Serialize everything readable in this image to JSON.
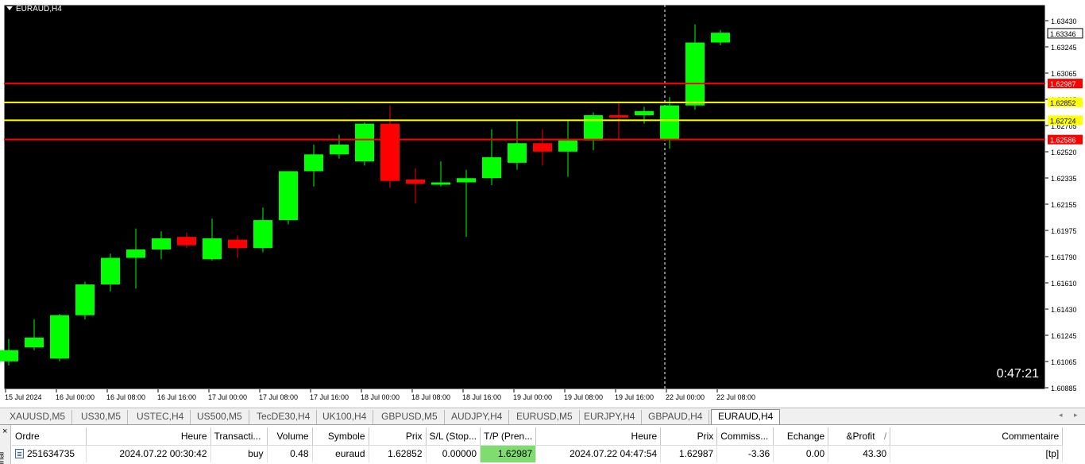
{
  "chart": {
    "title": "EURAUD,H4",
    "timer": "0:47:21",
    "colors": {
      "background": "#000000",
      "bull": "#00ff00",
      "bear": "#ff0000",
      "axis_text": "#000000",
      "grid_frame": "#ffffff"
    },
    "price_ticks": [
      "1.63430",
      "1.63245",
      "1.63065",
      "1.62885",
      "1.62705",
      "1.62520",
      "1.62335",
      "1.62155",
      "1.61975",
      "1.61790",
      "1.61610",
      "1.61430",
      "1.61245",
      "1.61065",
      "1.60885"
    ],
    "time_labels": [
      "15 Jul 2024",
      "16 Jul 00:00",
      "16 Jul 08:00",
      "16 Jul 16:00",
      "17 Jul 00:00",
      "17 Jul 08:00",
      "17 Jul 16:00",
      "18 Jul 00:00",
      "18 Jul 08:00",
      "18 Jul 16:00",
      "19 Jul 00:00",
      "19 Jul 08:00",
      "19 Jul 16:00",
      "22 Jul 00:00",
      "22 Jul 08:00"
    ],
    "price_lines": [
      {
        "label": "1.62987",
        "price": 1.62987,
        "color": "#ff0000",
        "label_bg": "#ff0000",
        "label_fg": "#ffffff"
      },
      {
        "label": "1.62852",
        "price": 1.62852,
        "color": "#ffff00",
        "label_bg": "#ffff00",
        "label_fg": "#000000"
      },
      {
        "label": "1.62724",
        "price": 1.62724,
        "color": "#ffff00",
        "label_bg": "#ffff00",
        "label_fg": "#000000"
      },
      {
        "label": "1.62586",
        "price": 1.62586,
        "color": "#ff0000",
        "label_bg": "#ff0000",
        "label_fg": "#ffffff"
      }
    ],
    "current_price": {
      "label": "1.63346",
      "price": 1.63346
    }
  },
  "chart_data": {
    "type": "candlestick",
    "title": "EURAUD,H4",
    "ylim": [
      1.608,
      1.6355
    ],
    "candles": [
      {
        "o": 1.61,
        "h": 1.6116,
        "l": 1.6097,
        "c": 1.6108
      },
      {
        "o": 1.611,
        "h": 1.613,
        "l": 1.6108,
        "c": 1.6117
      },
      {
        "o": 1.6102,
        "h": 1.6134,
        "l": 1.61,
        "c": 1.6133
      },
      {
        "o": 1.6133,
        "h": 1.6157,
        "l": 1.613,
        "c": 1.6155
      },
      {
        "o": 1.6155,
        "h": 1.6177,
        "l": 1.615,
        "c": 1.6174
      },
      {
        "o": 1.6174,
        "h": 1.6195,
        "l": 1.6152,
        "c": 1.618
      },
      {
        "o": 1.618,
        "h": 1.6193,
        "l": 1.6173,
        "c": 1.6188
      },
      {
        "o": 1.6189,
        "h": 1.6192,
        "l": 1.6181,
        "c": 1.6183
      },
      {
        "o": 1.6173,
        "h": 1.6202,
        "l": 1.6172,
        "c": 1.6188
      },
      {
        "o": 1.6187,
        "h": 1.619,
        "l": 1.6174,
        "c": 1.6181
      },
      {
        "o": 1.6181,
        "h": 1.621,
        "l": 1.6178,
        "c": 1.6201
      },
      {
        "o": 1.6201,
        "h": 1.6236,
        "l": 1.6198,
        "c": 1.6236
      },
      {
        "o": 1.6236,
        "h": 1.6255,
        "l": 1.6225,
        "c": 1.6248
      },
      {
        "o": 1.6248,
        "h": 1.6262,
        "l": 1.6245,
        "c": 1.6255
      },
      {
        "o": 1.6243,
        "h": 1.6271,
        "l": 1.624,
        "c": 1.627
      },
      {
        "o": 1.627,
        "h": 1.6283,
        "l": 1.6224,
        "c": 1.6229
      },
      {
        "o": 1.623,
        "h": 1.6238,
        "l": 1.6213,
        "c": 1.6227
      },
      {
        "o": 1.6227,
        "h": 1.6243,
        "l": 1.6225,
        "c": 1.6228
      },
      {
        "o": 1.6228,
        "h": 1.6237,
        "l": 1.6189,
        "c": 1.6231
      },
      {
        "o": 1.6231,
        "h": 1.6266,
        "l": 1.6226,
        "c": 1.6246
      },
      {
        "o": 1.6242,
        "h": 1.6273,
        "l": 1.6237,
        "c": 1.6256
      },
      {
        "o": 1.6256,
        "h": 1.6266,
        "l": 1.624,
        "c": 1.625
      },
      {
        "o": 1.625,
        "h": 1.6272,
        "l": 1.6232,
        "c": 1.6258
      },
      {
        "o": 1.6258,
        "h": 1.6278,
        "l": 1.6251,
        "c": 1.6276
      },
      {
        "o": 1.6276,
        "h": 1.6286,
        "l": 1.6258,
        "c": 1.6275
      },
      {
        "o": 1.6276,
        "h": 1.6282,
        "l": 1.627,
        "c": 1.6279
      },
      {
        "o": 1.6259,
        "h": 1.6289,
        "l": 1.6252,
        "c": 1.6283
      },
      {
        "o": 1.6283,
        "h": 1.6341,
        "l": 1.628,
        "c": 1.6328
      },
      {
        "o": 1.6328,
        "h": 1.6337,
        "l": 1.6326,
        "c": 1.6335
      }
    ],
    "hlines": [
      1.62987,
      1.62852,
      1.62724,
      1.62586
    ]
  },
  "tabs": [
    {
      "label": "XAUUSD,M5",
      "active": false
    },
    {
      "label": "US30,M5",
      "active": false
    },
    {
      "label": "USTEC,H4",
      "active": false
    },
    {
      "label": "US500,M5",
      "active": false
    },
    {
      "label": "TecDE30,H4",
      "active": false
    },
    {
      "label": "UK100,H4",
      "active": false
    },
    {
      "label": "GBPUSD,M5",
      "active": false
    },
    {
      "label": "AUDJPY,H4",
      "active": false
    },
    {
      "label": "EURUSD,M5",
      "active": false
    },
    {
      "label": "EURJPY,H4",
      "active": false
    },
    {
      "label": "GBPAUD,H4",
      "active": false
    },
    {
      "label": "EURAUD,H4",
      "active": true
    }
  ],
  "tab_nav": {
    "prev": "◂",
    "next": "▸"
  },
  "terminal": {
    "close": "×",
    "side_label": "inal",
    "headers": [
      "Ordre",
      "Heure",
      "Transacti...",
      "Volume",
      "Symbole",
      "Prix",
      "S/L (Stop...",
      "T/P (Pren...",
      "Heure",
      "Prix",
      "Commiss...",
      "Echange",
      "&Profit",
      "Commentaire"
    ],
    "sort_indicator": "/",
    "rows": [
      {
        "order": "251634735",
        "open_time": "2024.07.22 00:30:42",
        "type": "buy",
        "volume": "0.48",
        "symbol": "euraud",
        "open_price": "1.62852",
        "sl": "0.00000",
        "tp": "1.62987",
        "close_time": "2024.07.22 04:47:54",
        "close_price": "1.62987",
        "commission": "-3.36",
        "swap": "0.00",
        "profit": "43.30",
        "comment": "[tp]"
      }
    ]
  }
}
